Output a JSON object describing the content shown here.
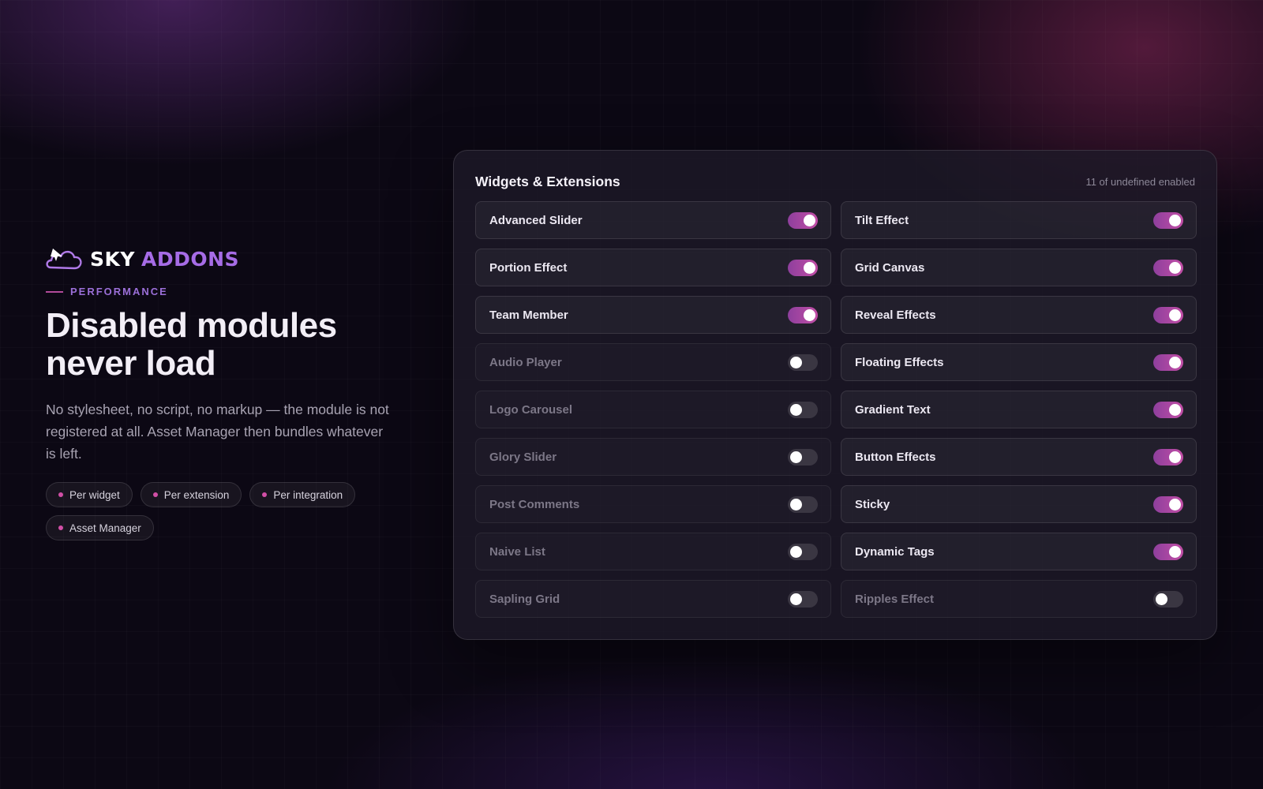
{
  "brand": {
    "sky": "SKY",
    "addons": "ADDONS",
    "accent": "#a66ce6"
  },
  "eyebrow": "PERFORMANCE",
  "headline_line1": "Disabled modules",
  "headline_line2": "never load",
  "description": "No stylesheet, no script, no markup — the module is not registered at all. Asset Manager then bundles whatever is left.",
  "chips": [
    "Per widget",
    "Per extension",
    "Per integration",
    "Asset Manager"
  ],
  "panel": {
    "title": "Widgets & Extensions",
    "count": "11 of undefined enabled",
    "left_column": [
      {
        "label": "Advanced Slider",
        "enabled": true
      },
      {
        "label": "Portion Effect",
        "enabled": true
      },
      {
        "label": "Team Member",
        "enabled": true
      },
      {
        "label": "Audio Player",
        "enabled": false
      },
      {
        "label": "Logo Carousel",
        "enabled": false
      },
      {
        "label": "Glory Slider",
        "enabled": false
      },
      {
        "label": "Post Comments",
        "enabled": false
      },
      {
        "label": "Naive List",
        "enabled": false
      },
      {
        "label": "Sapling Grid",
        "enabled": false
      }
    ],
    "right_column": [
      {
        "label": "Tilt Effect",
        "enabled": true
      },
      {
        "label": "Grid Canvas",
        "enabled": true
      },
      {
        "label": "Reveal Effects",
        "enabled": true
      },
      {
        "label": "Floating Effects",
        "enabled": true
      },
      {
        "label": "Gradient Text",
        "enabled": true
      },
      {
        "label": "Button Effects",
        "enabled": true
      },
      {
        "label": "Sticky",
        "enabled": true
      },
      {
        "label": "Dynamic Tags",
        "enabled": true
      },
      {
        "label": "Ripples Effect",
        "enabled": false
      }
    ]
  },
  "colors": {
    "toggle_on": "#c24ea6",
    "toggle_off": "#3a3642",
    "background": "#0c0814"
  }
}
